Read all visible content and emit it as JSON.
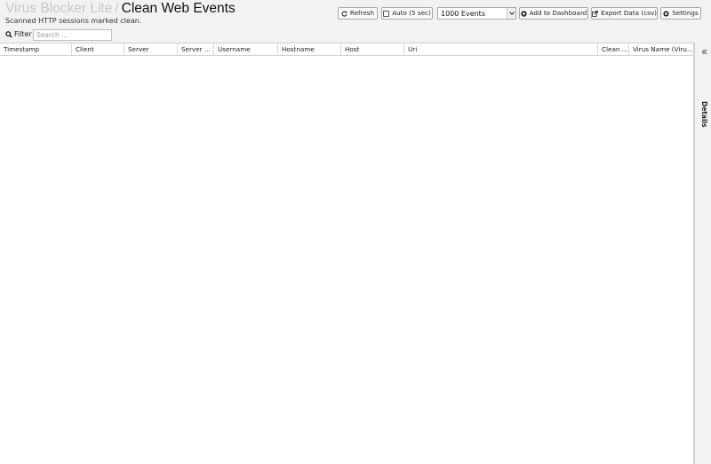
{
  "header": {
    "app_name": "Virus Blocker Lite",
    "separator": "/",
    "title": "Clean Web Events",
    "subtitle": "Scanned HTTP sessions marked clean."
  },
  "toolbar": {
    "refresh_label": "Refresh",
    "auto_label": "Auto (5 sec)",
    "auto_checked": false,
    "events_selected": "1000 Events",
    "add_dashboard_label": "Add to Dashboard",
    "export_label": "Export Data (csv)",
    "settings_label": "Settings"
  },
  "filter": {
    "label": "Filter",
    "placeholder": "Search ..."
  },
  "grid": {
    "columns": [
      "Timestamp",
      "Client",
      "Server",
      "Server ...",
      "Username",
      "Hostname",
      "Host",
      "Uri",
      "Clean ...",
      "Virus Name (Viru..."
    ],
    "rows": []
  },
  "details_panel": {
    "label": "Details"
  },
  "icons": {
    "refresh": "refresh-icon",
    "add_dashboard": "plus-circle-icon",
    "export": "export-icon",
    "settings": "gear-icon",
    "search": "search-icon",
    "collapse": "double-chevron-left-icon",
    "dropdown": "chevron-down-icon"
  }
}
